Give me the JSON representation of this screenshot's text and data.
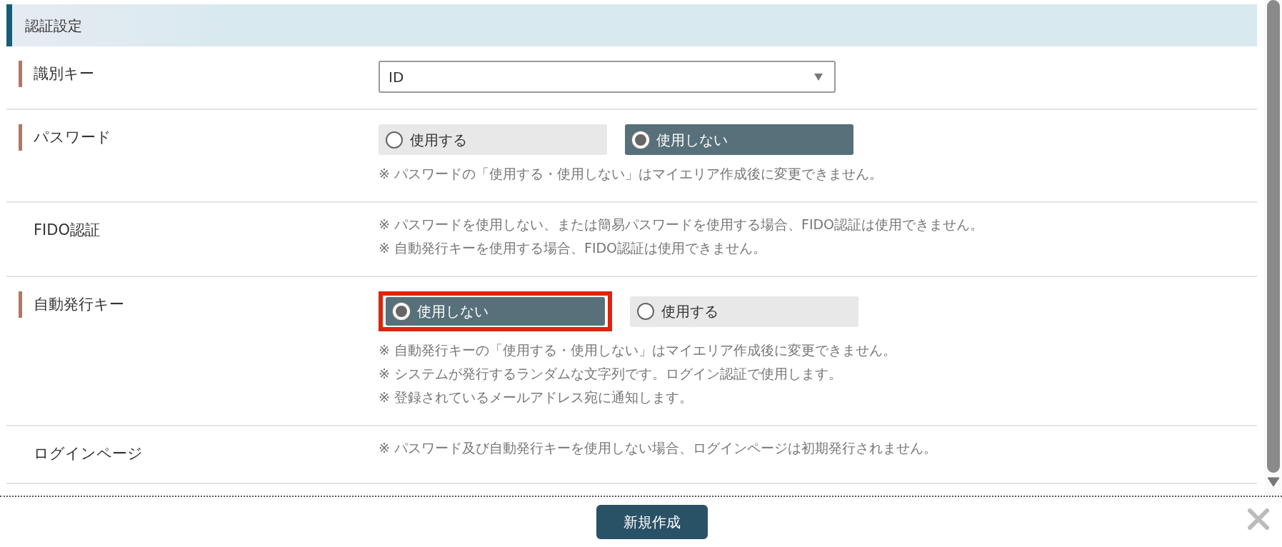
{
  "section": {
    "title": "認証設定"
  },
  "rows": [
    {
      "label": "識別キー",
      "required": true,
      "kind": "select",
      "value": "ID"
    },
    {
      "label": "パスワード",
      "required": true,
      "kind": "radio",
      "highlighted": false,
      "options": [
        {
          "label": "使用する",
          "selected": false
        },
        {
          "label": "使用しない",
          "selected": true
        }
      ],
      "notes": [
        "※ パスワードの「使用する・使用しない」はマイエリア作成後に変更できません。"
      ]
    },
    {
      "label": "FIDO認証",
      "required": false,
      "kind": "notes",
      "notes": [
        "※ パスワードを使用しない、または簡易パスワードを使用する場合、FIDO認証は使用できません。",
        "※ 自動発行キーを使用する場合、FIDO認証は使用できません。"
      ]
    },
    {
      "label": "自動発行キー",
      "required": true,
      "kind": "radio",
      "highlighted": true,
      "options": [
        {
          "label": "使用しない",
          "selected": true
        },
        {
          "label": "使用する",
          "selected": false
        }
      ],
      "notes": [
        "※ 自動発行キーの「使用する・使用しない」はマイエリア作成後に変更できません。",
        "※ システムが発行するランダムな文字列です。ログイン認証で使用します。",
        "※ 登録されているメールアドレス宛に通知します。"
      ]
    },
    {
      "label": "ログインページ",
      "required": false,
      "kind": "notes",
      "notes": [
        "※ パスワード及び自動発行キーを使用しない場合、ログインページは初期発行されません。"
      ]
    }
  ],
  "footer": {
    "button": "新規作成"
  }
}
